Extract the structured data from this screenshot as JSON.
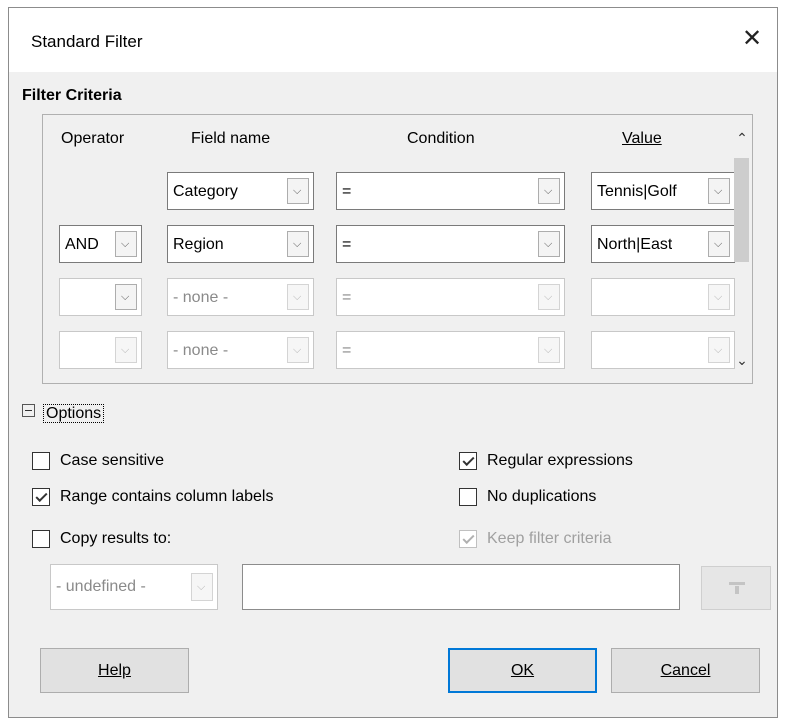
{
  "dialog": {
    "title": "Standard Filter"
  },
  "filter_criteria": {
    "heading": "Filter Criteria",
    "columns": {
      "operator": "Operator",
      "field_name": "Field name",
      "condition": "Condition",
      "value": "Value"
    },
    "rows": [
      {
        "operator": "",
        "field": "Category",
        "condition": "=",
        "value": "Tennis|Golf",
        "enabled": true,
        "has_operator": false
      },
      {
        "operator": "AND",
        "field": "Region",
        "condition": "=",
        "value": "North|East",
        "enabled": true,
        "has_operator": true
      },
      {
        "operator": "",
        "field": "- none -",
        "condition": "=",
        "value": "",
        "enabled": false,
        "has_operator": true
      },
      {
        "operator": "",
        "field": "- none -",
        "condition": "=",
        "value": "",
        "enabled": false,
        "has_operator": true
      }
    ]
  },
  "options": {
    "label": "Options",
    "expanded": true,
    "case_sensitive": {
      "label": "Case sensitive",
      "checked": false
    },
    "range_contains_labels": {
      "label": "Range contains column labels",
      "checked": true
    },
    "copy_results_to": {
      "label": "Copy results to:",
      "checked": false
    },
    "regular_expressions": {
      "label": "Regular expressions",
      "checked": true
    },
    "no_duplications": {
      "label": "No duplications",
      "checked": false
    },
    "keep_filter_criteria": {
      "label": "Keep filter criteria",
      "checked": true,
      "enabled": false
    },
    "copy_target": {
      "value": "- undefined -",
      "text": ""
    }
  },
  "buttons": {
    "help": "Help",
    "ok": "OK",
    "cancel": "Cancel"
  },
  "icons": {
    "close": "close-icon",
    "expander": "collapse-icon",
    "dropdown": "chevron-down-icon",
    "scroll_up": "scroll-up-icon",
    "scroll_down": "scroll-down-icon",
    "shrink": "shrink-icon"
  },
  "colors": {
    "default_button_border": "#0078d7",
    "dialog_bg": "#f0f0f0"
  }
}
